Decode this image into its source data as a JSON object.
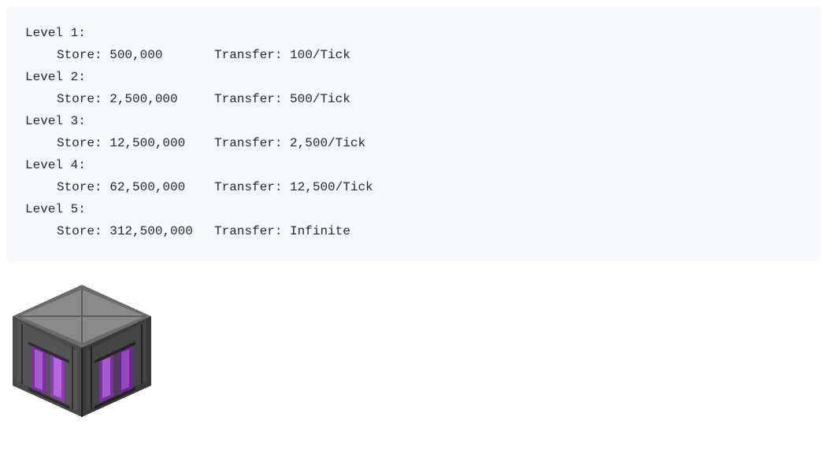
{
  "levels": [
    {
      "title": "Level 1:",
      "store_label": "Store:",
      "store_value": "500,000",
      "transfer_label": "Transfer:",
      "transfer_value": "100/Tick"
    },
    {
      "title": "Level 2:",
      "store_label": "Store:",
      "store_value": "2,500,000",
      "transfer_label": "Transfer:",
      "transfer_value": "500/Tick"
    },
    {
      "title": "Level 3:",
      "store_label": "Store:",
      "store_value": "12,500,000",
      "transfer_label": "Transfer:",
      "transfer_value": "2,500/Tick"
    },
    {
      "title": "Level 4:",
      "store_label": "Store:",
      "store_value": "62,500,000",
      "transfer_label": "Transfer:",
      "transfer_value": "12,500/Tick"
    },
    {
      "title": "Level 5:",
      "store_label": "Store:",
      "store_value": "312,500,000",
      "transfer_label": "Transfer:",
      "transfer_value": "Infinite"
    }
  ],
  "icon_name": "storage-block-icon"
}
